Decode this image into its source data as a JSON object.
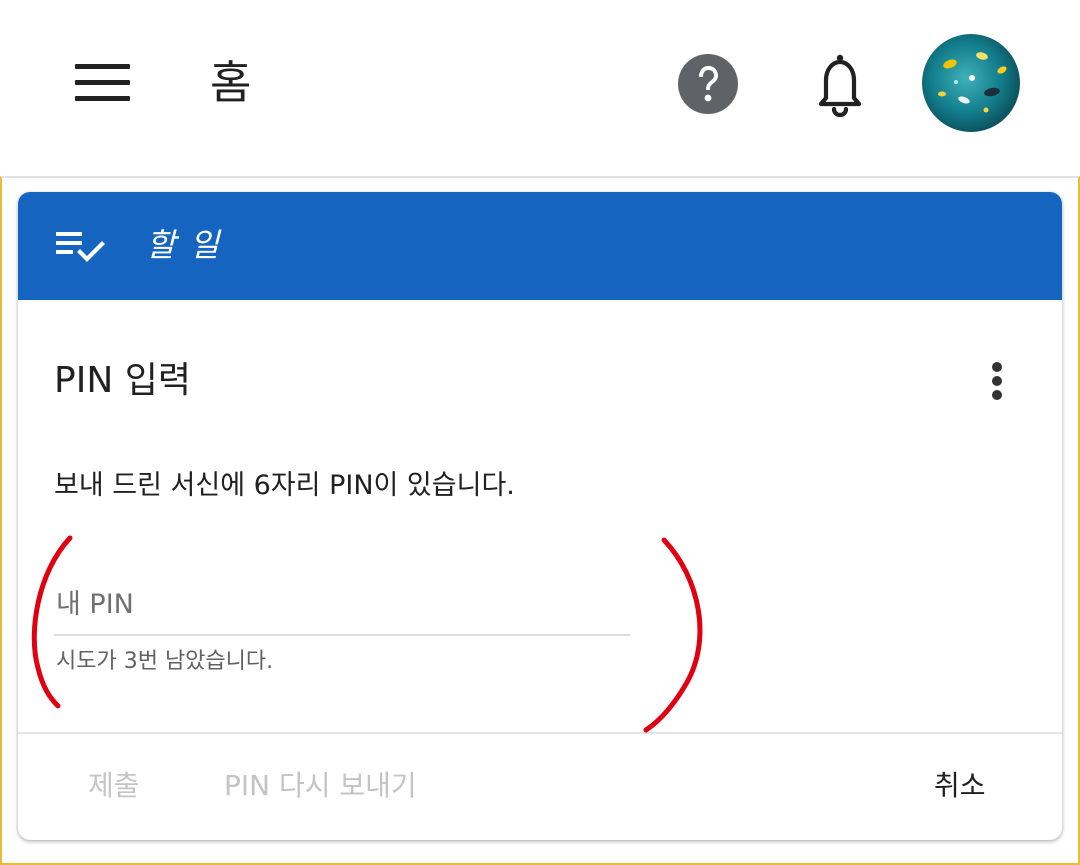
{
  "appbar": {
    "menu_icon": "hamburger-menu-icon",
    "title": "홈",
    "help_icon": "help-circle-icon",
    "notification_icon": "bell-icon",
    "avatar_icon": "user-avatar"
  },
  "card": {
    "header_icon": "task-list-check-icon",
    "header_label": "할 일",
    "title": "PIN 입력",
    "more_icon": "more-vertical-icon",
    "description": "보내 드린 서신에 6자리 PIN이 있습니다.",
    "pin_input": {
      "value": "",
      "placeholder": "내 PIN"
    },
    "helper_text": "시도가 3번 남았습니다.",
    "actions": {
      "submit_label": "제출",
      "resend_label": "PIN 다시 보내기",
      "cancel_label": "취소"
    }
  },
  "colors": {
    "header_blue": "#1565c0",
    "annotation_red": "#e0000f",
    "content_border": "#e6bd3a",
    "disabled_text": "#c4c4c4"
  }
}
